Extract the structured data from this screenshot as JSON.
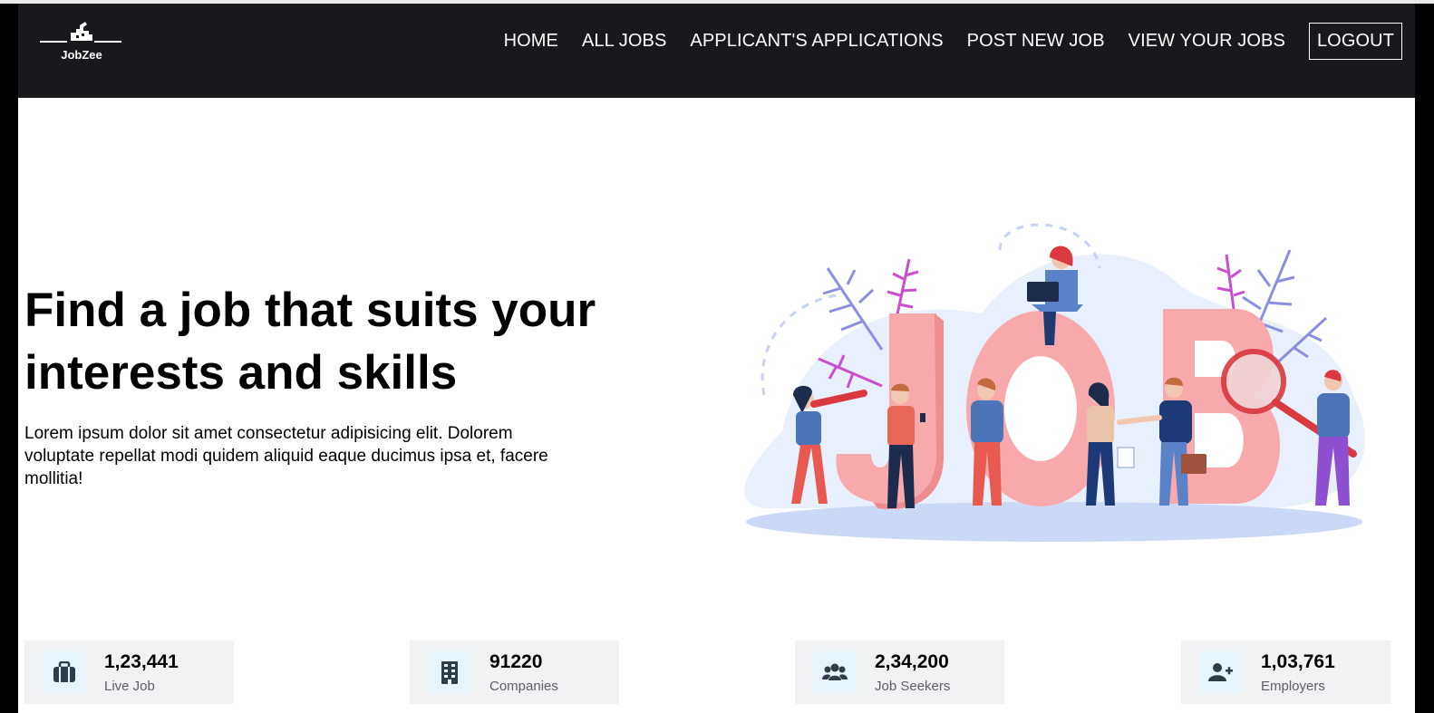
{
  "brand": {
    "name": "JobZee"
  },
  "nav": {
    "items": [
      {
        "label": "HOME"
      },
      {
        "label": "ALL JOBS"
      },
      {
        "label": "APPLICANT'S APPLICATIONS"
      },
      {
        "label": "POST NEW JOB"
      },
      {
        "label": "VIEW YOUR JOBS"
      }
    ],
    "logout": "LOGOUT"
  },
  "hero": {
    "title": "Find a job that suits your interests and skills",
    "description": "Lorem ipsum dolor sit amet consectetur adipisicing elit. Dolorem voluptate repellat modi quidem aliquid eaque ducimus ipsa et, facere mollitia!",
    "illustration_letters": "JOB"
  },
  "stats": [
    {
      "value": "1,23,441",
      "label": "Live Job",
      "icon": "briefcase-icon"
    },
    {
      "value": "91220",
      "label": "Companies",
      "icon": "building-icon"
    },
    {
      "value": "2,34,200",
      "label": "Job Seekers",
      "icon": "users-icon"
    },
    {
      "value": "1,03,761",
      "label": "Employers",
      "icon": "user-plus-icon"
    }
  ],
  "colors": {
    "navbar_bg": "#17191c",
    "stat_bg": "#f1f2f4",
    "stat_icon_bg": "#e6f4fb",
    "stat_icon_fg": "#2d3e48",
    "letters_pink": "#f7a9ab",
    "blob_blue": "#dbe6fb"
  }
}
